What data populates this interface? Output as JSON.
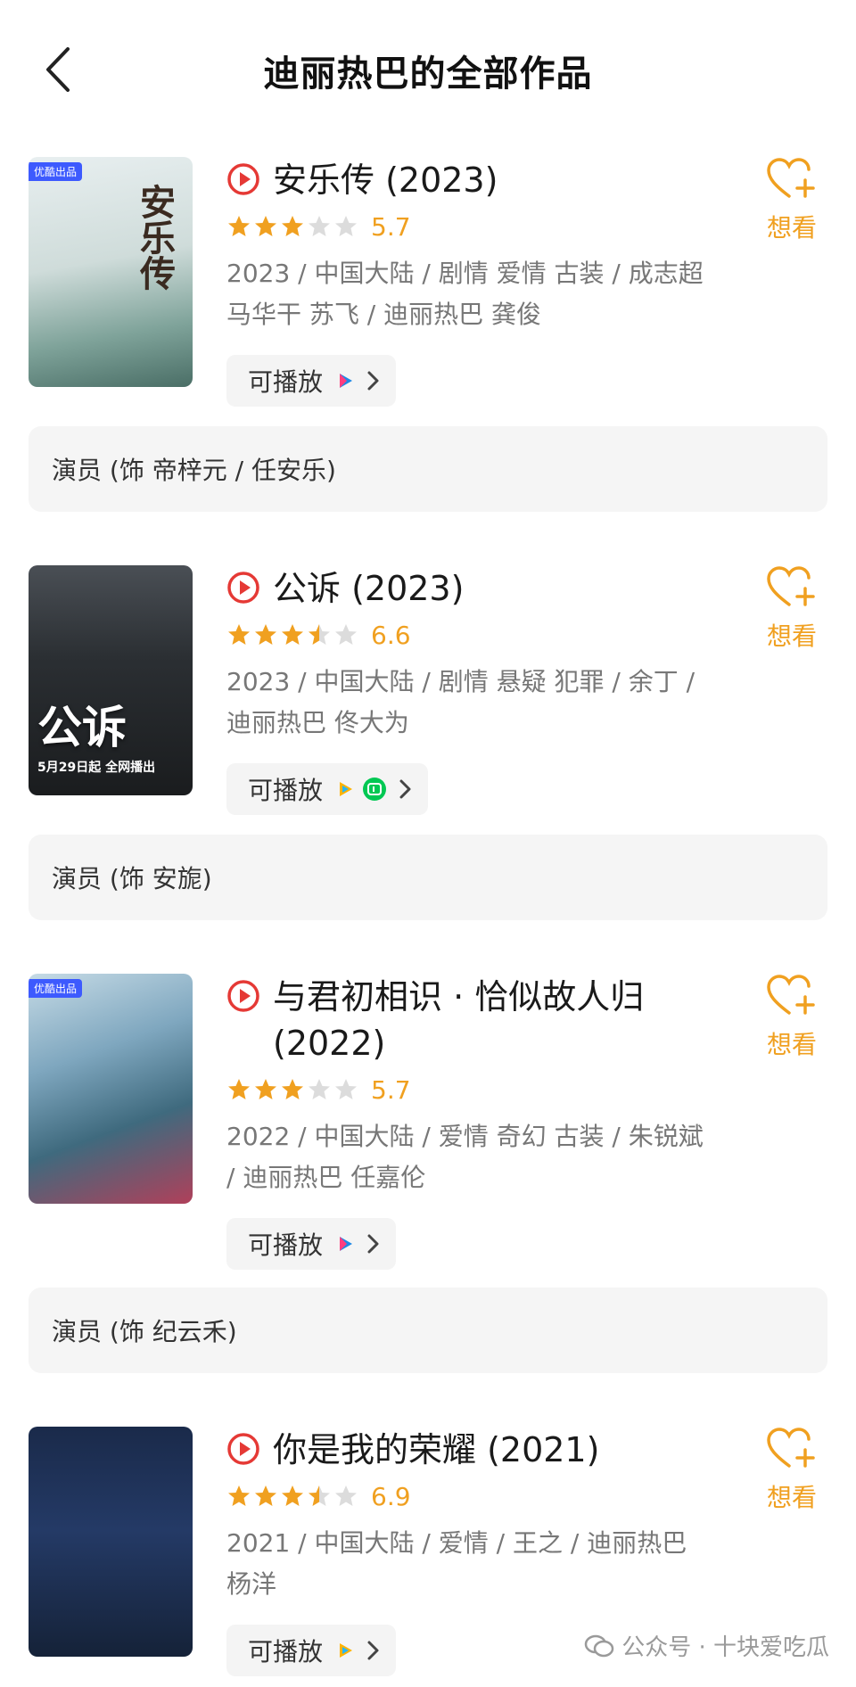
{
  "header": {
    "title": "迪丽热巴的全部作品"
  },
  "works": [
    {
      "title": "安乐传 (2023)",
      "score": "5.7",
      "meta": "2023 / 中国大陆 / 剧情 爱情 古装 / 成志超 马华干 苏飞 / 迪丽热巴 龚俊",
      "play_label": "可播放",
      "want_label": "想看",
      "role": "演员 (饰 帝梓元 / 任安乐)",
      "poster_text": "安乐传",
      "poster_badge": "优酷出品",
      "rating_stars": 3
    },
    {
      "title": "公诉 (2023)",
      "score": "6.6",
      "meta": "2023 / 中国大陆 / 剧情 悬疑 犯罪 / 余丁 / 迪丽热巴 佟大为",
      "play_label": "可播放",
      "want_label": "想看",
      "role": "演员 (饰 安旎)",
      "poster_text": "公诉",
      "poster_sub": "5月29日起 全网播出",
      "rating_stars": 3.5
    },
    {
      "title": "与君初相识 · 恰似故人归 (2022)",
      "score": "5.7",
      "meta": "2022 / 中国大陆 / 爱情 奇幻 古装 / 朱锐斌 / 迪丽热巴 任嘉伦",
      "play_label": "可播放",
      "want_label": "想看",
      "role": "演员 (饰 纪云禾)",
      "poster_badge": "优酷出品",
      "rating_stars": 3
    },
    {
      "title": "你是我的荣耀 (2021)",
      "score": "6.9",
      "meta": "2021 / 中国大陆 / 爱情 / 王之 / 迪丽热巴 杨洋",
      "play_label": "可播放",
      "want_label": "想看",
      "rating_stars": 3.5
    }
  ],
  "watermark": "公众号 · 十块爱吃瓜",
  "colors": {
    "accent": "#f0a020",
    "play_red": "#e53935",
    "chip_bg": "#f4f4f4"
  }
}
